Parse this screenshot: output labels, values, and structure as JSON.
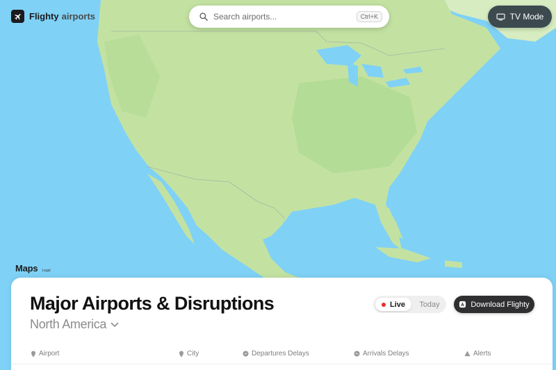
{
  "brand": {
    "name": "Flighty",
    "sub": "airports"
  },
  "search": {
    "placeholder": "Search airports...",
    "shortcut": "Ctrl+K"
  },
  "tv_mode": {
    "label": "TV Mode"
  },
  "map": {
    "attribution": "Maps",
    "legal": "Legal"
  },
  "panel": {
    "title": "Major Airports & Disruptions",
    "region": "North America",
    "toggle": {
      "live": "Live",
      "today": "Today"
    },
    "download_label": "Download Flighty",
    "columns": [
      "Airport",
      "City",
      "Departures Delays",
      "Arrivals Delays",
      "Alerts"
    ]
  },
  "colors": {
    "ocean": "#7fd1f6",
    "land": "#c6e6a6",
    "live": "#e52f2f",
    "dark_button": "#2f2f31"
  }
}
